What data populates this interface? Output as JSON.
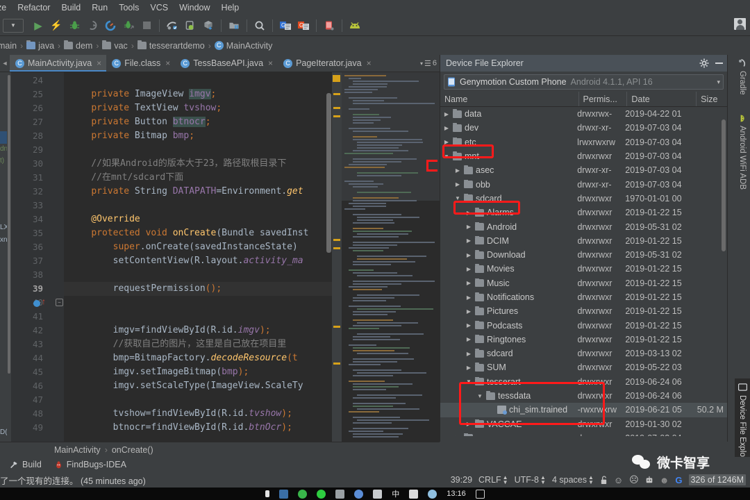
{
  "menubar": {
    "items": [
      {
        "label": "ze",
        "truncated": true
      },
      {
        "label": "Refactor"
      },
      {
        "label": "Build"
      },
      {
        "label": "Run"
      },
      {
        "label": "Tools"
      },
      {
        "label": "VCS"
      },
      {
        "label": "Window"
      },
      {
        "label": "Help"
      }
    ]
  },
  "toolbar": {
    "items": [
      {
        "name": "module-dropdown",
        "icon": "chevron-down-icon"
      },
      {
        "name": "run-button",
        "icon": "play-icon"
      },
      {
        "name": "apply-changes-button",
        "icon": "lightning-icon"
      },
      {
        "name": "debug-button",
        "icon": "bug-icon"
      },
      {
        "name": "run-with-coverage-button",
        "icon": "coverage-icon"
      },
      {
        "name": "profile-button",
        "icon": "gauge-icon"
      },
      {
        "name": "attach-debugger-button",
        "icon": "attach-debugger-icon"
      },
      {
        "name": "stop-button",
        "icon": "stop-icon"
      },
      {
        "name": "sync-gradle-button",
        "icon": "gradle-sync-icon"
      },
      {
        "name": "avd-manager-button",
        "icon": "avd-manager-icon"
      },
      {
        "name": "sdk-manager-button",
        "icon": "sdk-manager-icon"
      },
      {
        "name": "project-structure-button",
        "icon": "project-structure-icon"
      },
      {
        "name": "search-everywhere-button",
        "icon": "search-icon"
      },
      {
        "name": "genymotion-device-button",
        "icon": "genymotion-blue-icon"
      },
      {
        "name": "genymotion-shell-button",
        "icon": "genymotion-orange-icon"
      },
      {
        "name": "device-file-explorer-button",
        "icon": "device-phone-icon"
      },
      {
        "name": "android-button",
        "icon": "android-head-icon"
      }
    ],
    "account_avatar": "user-avatar"
  },
  "breadcrumb": {
    "items": [
      {
        "label": "main",
        "icon": "none"
      },
      {
        "label": "java",
        "icon": "folder-blue-icon"
      },
      {
        "label": "dem",
        "icon": "package-icon"
      },
      {
        "label": "vac",
        "icon": "package-icon"
      },
      {
        "label": "tesserartdemo",
        "icon": "package-icon"
      },
      {
        "label": "MainActivity",
        "icon": "class-icon"
      }
    ],
    "separator": "›"
  },
  "editor_tabs": {
    "scroll_left_icon": "chevron-left-icon",
    "tabs": [
      {
        "label": "MainActivity.java",
        "icon": "java-class-icon",
        "active": true,
        "close": "×"
      },
      {
        "label": "File.class",
        "icon": "java-class-locked-icon",
        "active": false,
        "close": "×"
      },
      {
        "label": "TessBaseAPI.java",
        "icon": "java-class-icon",
        "active": false,
        "close": "×"
      },
      {
        "label": "PageIterator.java",
        "icon": "java-class-icon",
        "active": false,
        "close": "×"
      }
    ],
    "overflow_label": "6",
    "overflow_icon": "tab-list-icon"
  },
  "editor": {
    "first_line": 24,
    "current_line": 39,
    "left_strip": {
      "texts": [
        "dn",
        "t)",
        "LXI",
        "xn",
        "D("
      ]
    },
    "lines": [
      {
        "n": 24,
        "segments": []
      },
      {
        "n": 25,
        "segments": [
          {
            "t": "    ",
            "c": ""
          },
          {
            "t": "private",
            "c": "kw"
          },
          {
            "t": " ImageView ",
            "c": "typ"
          },
          {
            "t": "imgv",
            "c": "fld hl-ident"
          },
          {
            "t": ";",
            "c": "kw"
          }
        ]
      },
      {
        "n": 26,
        "segments": [
          {
            "t": "    ",
            "c": ""
          },
          {
            "t": "private",
            "c": "kw"
          },
          {
            "t": " TextView ",
            "c": "typ"
          },
          {
            "t": "tvshow",
            "c": "fld"
          },
          {
            "t": ";",
            "c": "kw"
          }
        ]
      },
      {
        "n": 27,
        "segments": [
          {
            "t": "    ",
            "c": ""
          },
          {
            "t": "private",
            "c": "kw"
          },
          {
            "t": " Button ",
            "c": "typ"
          },
          {
            "t": "btnocr",
            "c": "fld hl-ident"
          },
          {
            "t": ";",
            "c": "kw"
          }
        ]
      },
      {
        "n": 28,
        "segments": [
          {
            "t": "    ",
            "c": ""
          },
          {
            "t": "private",
            "c": "kw"
          },
          {
            "t": " Bitmap ",
            "c": "typ"
          },
          {
            "t": "bmp",
            "c": "fld"
          },
          {
            "t": ";",
            "c": "kw"
          }
        ]
      },
      {
        "n": 29,
        "segments": []
      },
      {
        "n": 30,
        "segments": [
          {
            "t": "    //如果Android的版本大于23，路径取根目录下",
            "c": "cmt"
          }
        ]
      },
      {
        "n": 31,
        "segments": [
          {
            "t": "    //在mnt/sdcard下面",
            "c": "cmt"
          }
        ]
      },
      {
        "n": 32,
        "segments": [
          {
            "t": "    ",
            "c": ""
          },
          {
            "t": "private",
            "c": "kw"
          },
          {
            "t": " String ",
            "c": "typ"
          },
          {
            "t": "DATAPATH",
            "c": "fld"
          },
          {
            "t": "=Environment.",
            "c": "typ"
          },
          {
            "t": "get",
            "c": "mtd itl"
          }
        ]
      },
      {
        "n": 33,
        "segments": []
      },
      {
        "n": 34,
        "segments": [
          {
            "t": "    @Override",
            "c": "mtd"
          }
        ]
      },
      {
        "n": 35,
        "segments": [
          {
            "t": "    ",
            "c": ""
          },
          {
            "t": "protected void ",
            "c": "kw"
          },
          {
            "t": "onCreate",
            "c": "mtd"
          },
          {
            "t": "(Bundle savedInst",
            "c": "typ"
          }
        ]
      },
      {
        "n": 36,
        "segments": [
          {
            "t": "        ",
            "c": ""
          },
          {
            "t": "super",
            "c": "kw"
          },
          {
            "t": ".onCreate(savedInstanceState)",
            "c": "typ"
          }
        ]
      },
      {
        "n": 37,
        "segments": [
          {
            "t": "        setContentView(R.layout.",
            "c": "typ"
          },
          {
            "t": "activity_ma",
            "c": "fld itl"
          }
        ]
      },
      {
        "n": 38,
        "segments": []
      },
      {
        "n": 39,
        "segments": [
          {
            "t": "        requestPermission",
            "c": "typ"
          },
          {
            "t": "();",
            "c": "kw"
          }
        ],
        "current": true
      },
      {
        "n": 40,
        "segments": []
      },
      {
        "n": 41,
        "segments": []
      },
      {
        "n": 42,
        "segments": [
          {
            "t": "        imgv=findViewById(R.id.",
            "c": "typ"
          },
          {
            "t": "imgv",
            "c": "fld itl"
          },
          {
            "t": ");",
            "c": "kw"
          }
        ]
      },
      {
        "n": 43,
        "segments": [
          {
            "t": "        //获取自己的图片，这里是自己放在项目里",
            "c": "cmt"
          }
        ]
      },
      {
        "n": 44,
        "segments": [
          {
            "t": "        bmp=BitmapFactory.",
            "c": "typ"
          },
          {
            "t": "decodeResource",
            "c": "mtd itl"
          },
          {
            "t": "(t",
            "c": "kw"
          }
        ]
      },
      {
        "n": 45,
        "segments": [
          {
            "t": "        imgv.setImageBitmap(",
            "c": "typ"
          },
          {
            "t": "bmp",
            "c": "fld"
          },
          {
            "t": ");",
            "c": "kw"
          }
        ]
      },
      {
        "n": 46,
        "segments": [
          {
            "t": "        imgv.setScaleType(ImageView.ScaleTy",
            "c": "typ"
          }
        ]
      },
      {
        "n": 47,
        "segments": []
      },
      {
        "n": 48,
        "segments": [
          {
            "t": "        tvshow=findViewById(R.id.",
            "c": "typ"
          },
          {
            "t": "tvshow",
            "c": "fld itl"
          },
          {
            "t": ");",
            "c": "kw"
          }
        ]
      },
      {
        "n": 49,
        "segments": [
          {
            "t": "        btnocr=findViewById(R.id.",
            "c": "typ"
          },
          {
            "t": "btnOcr",
            "c": "fld itl"
          },
          {
            "t": ");",
            "c": "kw"
          }
        ]
      }
    ]
  },
  "device_file_explorer": {
    "title": "Device File Explorer",
    "settings_icon": "gear-icon",
    "minimize_icon": "minimize-icon",
    "device": {
      "icon": "phone-icon",
      "name": "Genymotion Custom Phone",
      "api": "Android 4.1.1, API 16",
      "caret": "▾"
    },
    "columns": [
      "Name",
      "Permis...",
      "Date",
      "Size"
    ],
    "rows": [
      {
        "name": "data",
        "indent": 0,
        "arrow": "▶",
        "icon": "folder",
        "perm": "drwxrwx-",
        "date": "2019-04-22 01",
        "size": ""
      },
      {
        "name": "dev",
        "indent": 0,
        "arrow": "▶",
        "icon": "folder",
        "perm": "drwxr-xr-",
        "date": "2019-07-03 04",
        "size": ""
      },
      {
        "name": "etc",
        "indent": 0,
        "arrow": "▶",
        "icon": "folder-link",
        "perm": "lrwxrwxrw",
        "date": "2019-07-03 04",
        "size": ""
      },
      {
        "name": "mnt",
        "indent": 0,
        "arrow": "▼",
        "icon": "folder",
        "perm": "drwxrwxr",
        "date": "2019-07-03 04",
        "size": ""
      },
      {
        "name": "asec",
        "indent": 1,
        "arrow": "▶",
        "icon": "folder",
        "perm": "drwxr-xr-",
        "date": "2019-07-03 04",
        "size": ""
      },
      {
        "name": "obb",
        "indent": 1,
        "arrow": "▶",
        "icon": "folder",
        "perm": "drwxr-xr-",
        "date": "2019-07-03 04",
        "size": ""
      },
      {
        "name": "sdcard",
        "indent": 1,
        "arrow": "▼",
        "icon": "folder",
        "perm": "drwxrwxr",
        "date": "1970-01-01 00",
        "size": ""
      },
      {
        "name": "Alarms",
        "indent": 2,
        "arrow": "▶",
        "icon": "folder",
        "perm": "drwxrwxr",
        "date": "2019-01-22 15",
        "size": ""
      },
      {
        "name": "Android",
        "indent": 2,
        "arrow": "▶",
        "icon": "folder",
        "perm": "drwxrwxr",
        "date": "2019-05-31 02",
        "size": ""
      },
      {
        "name": "DCIM",
        "indent": 2,
        "arrow": "▶",
        "icon": "folder",
        "perm": "drwxrwxr",
        "date": "2019-01-22 15",
        "size": ""
      },
      {
        "name": "Download",
        "indent": 2,
        "arrow": "▶",
        "icon": "folder",
        "perm": "drwxrwxr",
        "date": "2019-05-31 02",
        "size": ""
      },
      {
        "name": "Movies",
        "indent": 2,
        "arrow": "▶",
        "icon": "folder",
        "perm": "drwxrwxr",
        "date": "2019-01-22 15",
        "size": ""
      },
      {
        "name": "Music",
        "indent": 2,
        "arrow": "▶",
        "icon": "folder",
        "perm": "drwxrwxr",
        "date": "2019-01-22 15",
        "size": ""
      },
      {
        "name": "Notifications",
        "indent": 2,
        "arrow": "▶",
        "icon": "folder",
        "perm": "drwxrwxr",
        "date": "2019-01-22 15",
        "size": ""
      },
      {
        "name": "Pictures",
        "indent": 2,
        "arrow": "▶",
        "icon": "folder",
        "perm": "drwxrwxr",
        "date": "2019-01-22 15",
        "size": ""
      },
      {
        "name": "Podcasts",
        "indent": 2,
        "arrow": "▶",
        "icon": "folder",
        "perm": "drwxrwxr",
        "date": "2019-01-22 15",
        "size": ""
      },
      {
        "name": "Ringtones",
        "indent": 2,
        "arrow": "▶",
        "icon": "folder",
        "perm": "drwxrwxr",
        "date": "2019-01-22 15",
        "size": ""
      },
      {
        "name": "sdcard",
        "indent": 2,
        "arrow": "▶",
        "icon": "folder",
        "perm": "drwxrwxr",
        "date": "2019-03-13 02",
        "size": ""
      },
      {
        "name": "SUM",
        "indent": 2,
        "arrow": "▶",
        "icon": "folder",
        "perm": "drwxrwxr",
        "date": "2019-05-22 03",
        "size": ""
      },
      {
        "name": "tesserart",
        "indent": 2,
        "arrow": "▼",
        "icon": "folder",
        "perm": "drwxrwxr",
        "date": "2019-06-24 06",
        "size": ""
      },
      {
        "name": "tessdata",
        "indent": 3,
        "arrow": "▼",
        "icon": "folder",
        "perm": "drwxrwxr",
        "date": "2019-06-24 06",
        "size": ""
      },
      {
        "name": "chi_sim.trained",
        "indent": 4,
        "arrow": "",
        "icon": "file-trained",
        "perm": "-rwxrwxrw",
        "date": "2019-06-21 05",
        "size": "50.2 M"
      },
      {
        "name": "VACCAE",
        "indent": 2,
        "arrow": "▶",
        "icon": "folder",
        "perm": "drwxrwxr",
        "date": "2019-01-30 02",
        "size": ""
      },
      {
        "name": "secure",
        "indent": 1,
        "arrow": "▶",
        "icon": "folder",
        "perm": "drwx-----",
        "date": "2019-07-03 04",
        "size": ""
      }
    ],
    "annotations": [
      {
        "name": "highlight-mnt"
      },
      {
        "name": "highlight-sdcard"
      },
      {
        "name": "highlight-tesserart-tessdata"
      }
    ]
  },
  "right_tool_tabs": [
    {
      "label": "Gradle",
      "icon": "gradle-icon",
      "active": false
    },
    {
      "label": "Android WiFi ADB",
      "icon": "android-icon",
      "active": false
    },
    {
      "label": "Device File Explorer",
      "icon": "device-explorer-icon",
      "active": true
    }
  ],
  "navigation_bar": {
    "items": [
      "MainActivity",
      "onCreate()"
    ],
    "separator": "›"
  },
  "bottom_tool_buttons": [
    {
      "label": "Build",
      "icon": "hammer-icon"
    },
    {
      "label": "FindBugs-IDEA",
      "icon": "findbugs-icon"
    }
  ],
  "status_bar": {
    "message": "了一个现有的连接。 (45 minutes ago)",
    "caret_position": "39:29",
    "line_separator": "CRLF",
    "encoding": "UTF-8",
    "indent": "4 spaces",
    "lock_icon": "unlocked-icon",
    "faces": [
      "smiley-happy-icon",
      "smiley-sad-icon",
      "robot-icon",
      "person-icon"
    ],
    "google_icon": "google-icon",
    "memory": "326 of 1246M"
  },
  "taskbar": {
    "time": "13:16",
    "icons": [
      "cursor-icon",
      "explorer-icon",
      "wechat-icon",
      "wechat2-icon",
      "app-icon",
      "edge-icon",
      "sound-icon",
      "ime-cn-icon",
      "screen-icon",
      "network-icon"
    ]
  },
  "watermark": {
    "text": "微卡智享",
    "icon": "wechat-logo-icon"
  },
  "colors": {
    "accent_blue": "#4a88c7",
    "annotation_red": "#ff1a1a",
    "panel_bg": "#3c3f41",
    "editor_bg": "#2b2b2b",
    "gutter_bg": "#313335",
    "title_bg": "#4a5158"
  }
}
